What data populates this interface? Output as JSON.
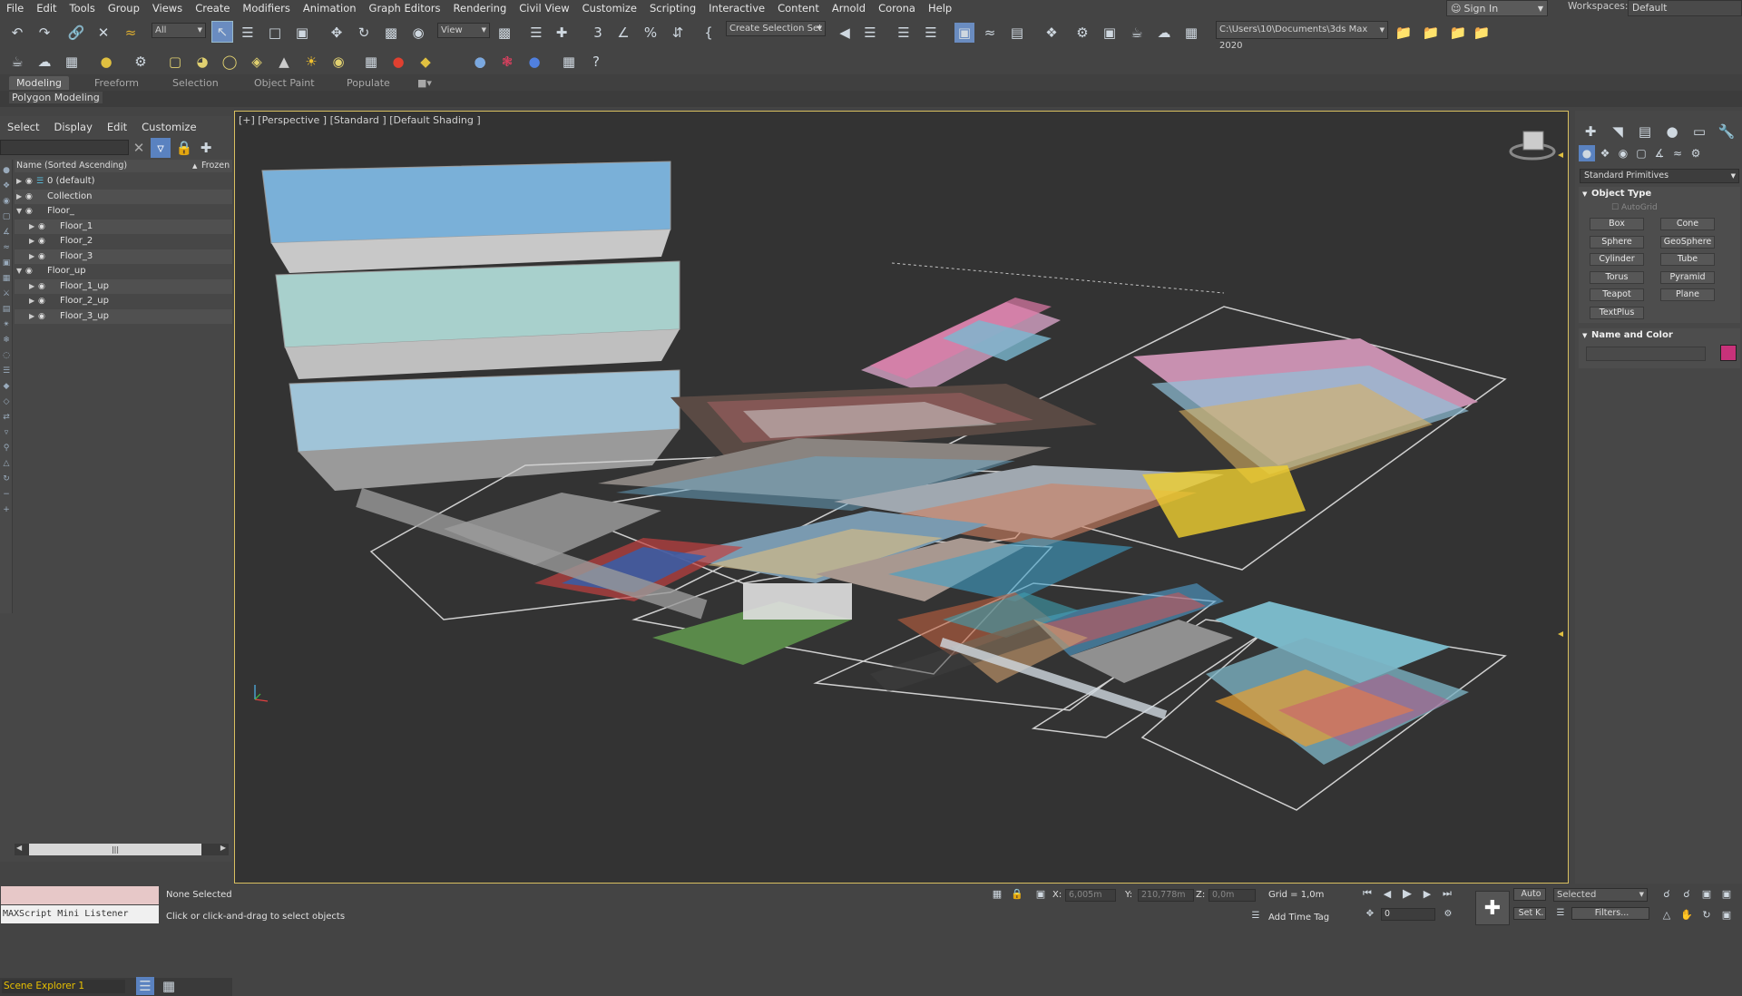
{
  "menu": {
    "items": [
      "File",
      "Edit",
      "Tools",
      "Group",
      "Views",
      "Create",
      "Modifiers",
      "Animation",
      "Graph Editors",
      "Rendering",
      "Civil View",
      "Customize",
      "Scripting",
      "Interactive",
      "Content",
      "Arnold",
      "Corona",
      "Help"
    ],
    "sign_in": "Sign In",
    "workspaces_label": "Workspaces:",
    "workspaces_value": "Default"
  },
  "toolbar": {
    "filter_value": "All",
    "ref_coord_value": "View",
    "selection_set_value": "Create Selection Set",
    "project_path": "C:\\Users\\10\\Documents\\3ds Max 2020"
  },
  "ribbon": {
    "tabs": [
      "Modeling",
      "Freeform",
      "Selection",
      "Object Paint",
      "Populate"
    ],
    "active_tab": "Modeling",
    "sub_label": "Polygon Modeling"
  },
  "explorer": {
    "menu": [
      "Select",
      "Display",
      "Edit",
      "Customize"
    ],
    "col_name": "Name (Sorted Ascending)",
    "col_frozen": "Frozen",
    "rows": [
      {
        "label": "0 (default)",
        "level": 0,
        "expanded": false,
        "layer": true
      },
      {
        "label": "Collection",
        "level": 0,
        "expanded": false
      },
      {
        "label": "Floor_",
        "level": 0,
        "expanded": true
      },
      {
        "label": "Floor_1",
        "level": 1,
        "expanded": false
      },
      {
        "label": "Floor_2",
        "level": 1,
        "expanded": false
      },
      {
        "label": "Floor_3",
        "level": 1,
        "expanded": false
      },
      {
        "label": "Floor_up",
        "level": 0,
        "expanded": true
      },
      {
        "label": "Floor_1_up",
        "level": 1,
        "expanded": false
      },
      {
        "label": "Floor_2_up",
        "level": 1,
        "expanded": false
      },
      {
        "label": "Floor_3_up",
        "level": 1,
        "expanded": false
      }
    ],
    "title": "Scene Explorer 1"
  },
  "viewport": {
    "label": "[+] [Perspective ] [Standard ] [Default Shading ]"
  },
  "command_panel": {
    "category": "Standard Primitives",
    "object_type_title": "Object Type",
    "autogrid": "AutoGrid",
    "buttons": [
      "Box",
      "Cone",
      "Sphere",
      "GeoSphere",
      "Cylinder",
      "Tube",
      "Torus",
      "Pyramid",
      "Teapot",
      "Plane",
      "TextPlus"
    ],
    "name_color_title": "Name and Color",
    "object_color": "#c8327a"
  },
  "status": {
    "listener_label": "MAXScript Mini Listener",
    "selection": "None Selected",
    "prompt": "Click or click-and-drag to select objects",
    "x_label": "X:",
    "x_value": "6,005m",
    "y_label": "Y:",
    "y_value": "210,778m",
    "z_label": "Z:",
    "z_value": "0,0m",
    "grid": "Grid = 1,0m",
    "add_time_tag": "Add Time Tag",
    "auto": "Auto",
    "selected_value": "Selected",
    "set_key": "Set K.",
    "filters": "Filters...",
    "frame_value": "0"
  }
}
